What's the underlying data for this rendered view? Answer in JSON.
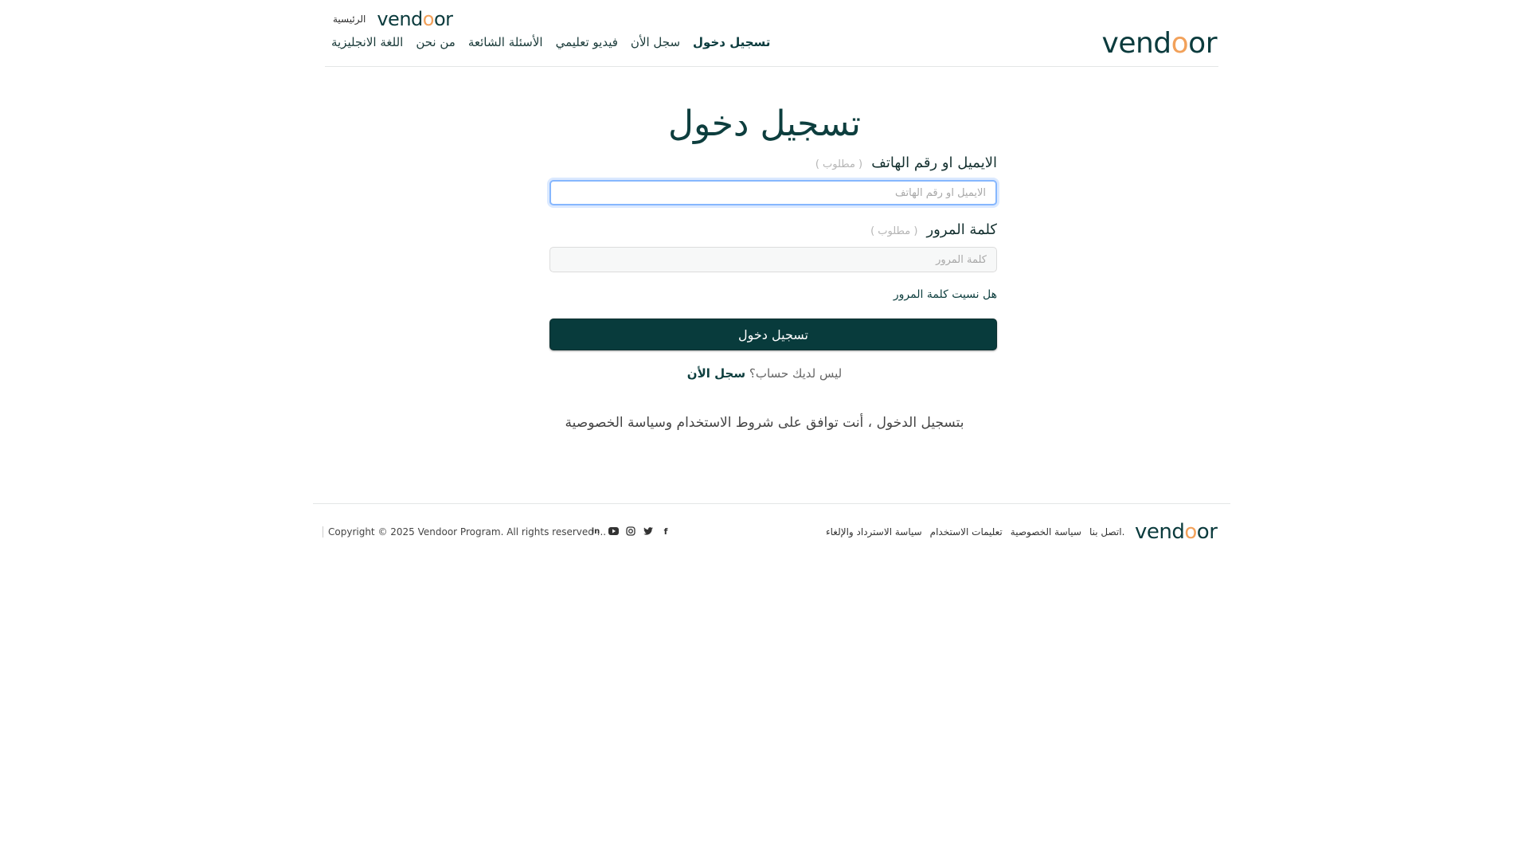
{
  "header": {
    "home_label": "الرئيسية",
    "logo_text_a": "vend",
    "logo_text_b": "o",
    "logo_text_c": "or",
    "nav": [
      {
        "label": "تسجيل دخول",
        "active": true
      },
      {
        "label": "سجل الأن"
      },
      {
        "label": "فيديو تعليمي"
      },
      {
        "label": "الأسئلة الشائعة"
      },
      {
        "label": "من نحن"
      },
      {
        "label": "اللغة الانجليزية"
      }
    ]
  },
  "form": {
    "title": "تسجيل دخول",
    "email_label": "الايميل او رقم الهاتف",
    "email_placeholder": "الايميل او رقم الهاتف",
    "required": "( مطلوب )",
    "password_label": "كلمة المرور",
    "password_placeholder": "كلمة المرور",
    "forgot": "هل نسيت كلمة المرور",
    "submit": "تسجيل دخول",
    "no_account": "ليس لديك حساب؟",
    "register_link": "سجل الأن",
    "terms": "بتسجيل الدخول ، أنت توافق على شروط الاستخدام وسياسة الخصوصية"
  },
  "footer": {
    "copyright": "Copyright © 2025 Vendoor Program. All rights reserved ...",
    "social": [
      "linkedin-icon",
      "youtube-icon",
      "instagram-icon",
      "twitter-icon",
      "facebook-icon"
    ],
    "links": [
      "اتصل بنا.",
      "سياسة الخصوصية",
      "تعليمات الاستخدام",
      "سياسة الاسترداد والإلغاء"
    ]
  },
  "colors": {
    "brand_dark": "#083b3c",
    "brand_accent": "#f2a15a",
    "focus_border": "#86b7fe"
  }
}
